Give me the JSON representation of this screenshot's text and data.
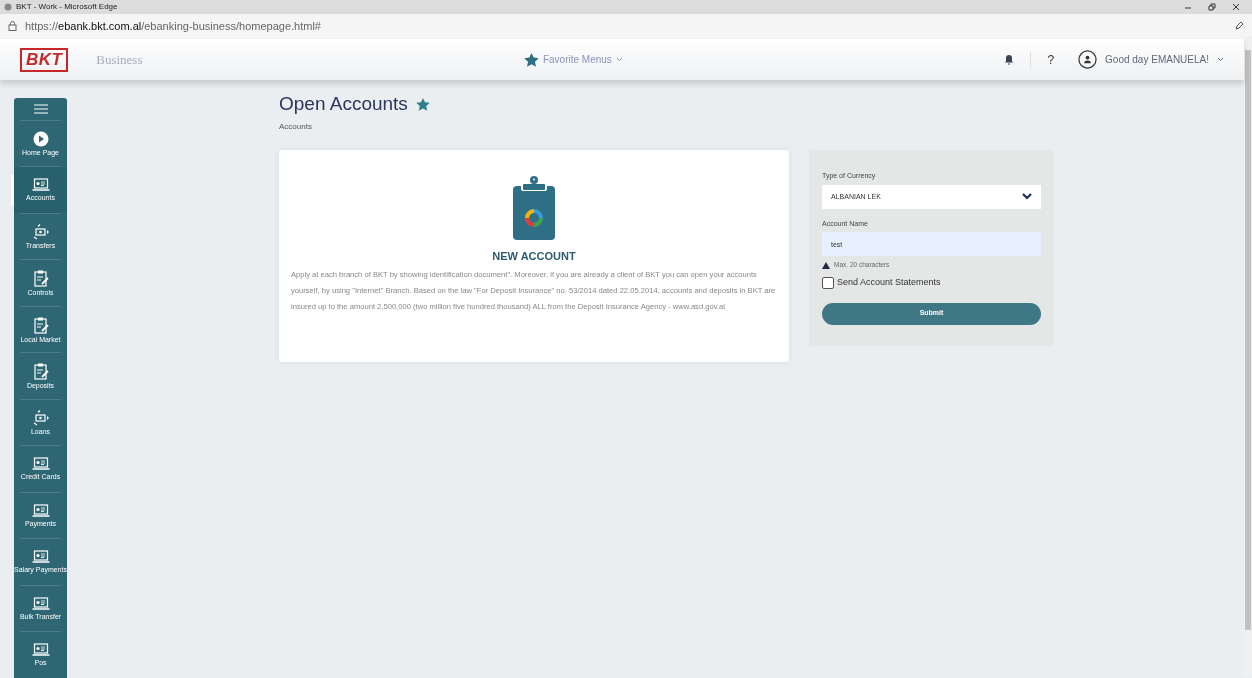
{
  "window": {
    "title": "BKT - Work - Microsoft Edge",
    "url": "https://**ebank.bkt.com.al**/ebanking-business/homepage.html#"
  },
  "header": {
    "logo": "BKT",
    "product": "Business",
    "favorites": "Favorite Menus",
    "greeting": "Good day EMANUELA!",
    "help": "?"
  },
  "sidebar": {
    "items": [
      {
        "label": "Home Page",
        "kind": "home",
        "selected": false
      },
      {
        "label": "Accounts",
        "kind": "laptop",
        "selected": true
      },
      {
        "label": "Transfers",
        "kind": "transfer",
        "selected": false
      },
      {
        "label": "Controls",
        "kind": "clipboard",
        "selected": false
      },
      {
        "label": "Local Market",
        "kind": "clipboard",
        "selected": false
      },
      {
        "label": "Deposits",
        "kind": "clipboard",
        "selected": false
      },
      {
        "label": "Loans",
        "kind": "transfer",
        "selected": false
      },
      {
        "label": "Credit Cards",
        "kind": "laptop",
        "selected": false
      },
      {
        "label": "Payments",
        "kind": "laptop",
        "selected": false
      },
      {
        "label": "Salary Payments",
        "kind": "laptop",
        "selected": false
      },
      {
        "label": "Bulk Transfer",
        "kind": "laptop",
        "selected": false
      },
      {
        "label": "Pos",
        "kind": "laptop",
        "selected": false
      }
    ]
  },
  "page": {
    "title": "Open Accounts",
    "breadcrumb": "Accounts"
  },
  "info_card": {
    "heading": "NEW ACCOUNT",
    "text": "Apply at each branch of BKT by showing identification document\". Moreover, if you are already a client of BKT you can open your accounts yourself, by using \"Internet\" Branch. Based on the law \"For Deposit Insurance\" no. 53/2014 dated 22.05.2014, accounts and deposits in BKT are insured up to the amount 2,500,000 (two million five hundred thousand) ALL from the Deposit Insurance Agency - www.asd.gov.al"
  },
  "form": {
    "currency_label": "Type of Currency",
    "currency_value": "ALBANIAN LEK",
    "name_label": "Account Name",
    "name_value": "test",
    "hint": "Max. 20 characters",
    "statements": {
      "label": "Send Account Statements",
      "checked": false
    },
    "submit": "Submit"
  }
}
